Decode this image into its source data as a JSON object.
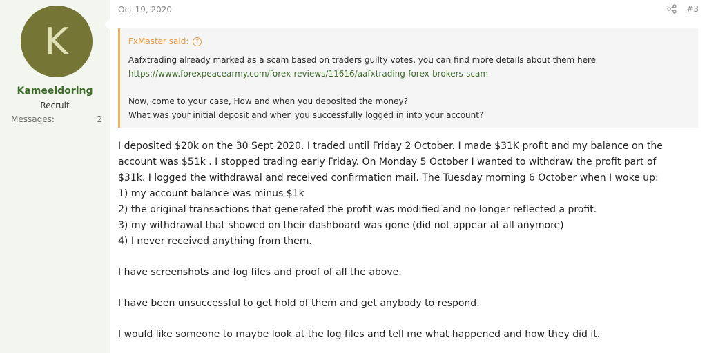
{
  "author": {
    "initial": "K",
    "name": "Kameeldoring",
    "title": "Recruit",
    "messages_label": "Messages:",
    "messages_count": "2",
    "avatar_color": "#757536"
  },
  "post": {
    "date": "Oct 19, 2020",
    "number": "#3",
    "quote": {
      "author": "FxMaster said:",
      "line1": "Aafxtrading already marked as a scam based on traders guilty votes, you can find more details about them here",
      "link": "https://www.forexpeacearmy.com/forex-reviews/11616/aafxtrading-forex-brokers-scam",
      "line2": "Now, come to your case, How and when you deposited the money?",
      "line3": "What was your initial deposit and when you successfully logged in into your account?"
    },
    "body": {
      "p1_l1": "I deposited $20k on the 30 Sept 2020. I traded until Friday 2 October. I made $31K profit and my balance on the",
      "p1_l2": "account was $51k . I stopped trading early Friday. On Monday 5 October I wanted to withdraw the profit part of",
      "p1_l3": "$31k. I logged the withdrawal and received confirmation mail. The Tuesday morning 6 October when I woke up:",
      "item1": "1) my account balance was minus $1k",
      "item2": "2) the original transactions that generated the profit was modified and no longer reflected a profit.",
      "item3": "3) my withdrawal that showed on their dashboard was gone (did not appear at all anymore)",
      "item4": "4) I never received anything from them.",
      "p2": "I have screenshots and log files and proof of all the above.",
      "p3": "I have been unsuccessful to get hold of them and get anybody to respond.",
      "p4": "I would like someone to maybe look at the log files and tell me what happened and how they did it."
    }
  },
  "colors": {
    "username": "#3d6b2a",
    "quote_accent": "#e0993e",
    "link": "#3d6b2a"
  }
}
